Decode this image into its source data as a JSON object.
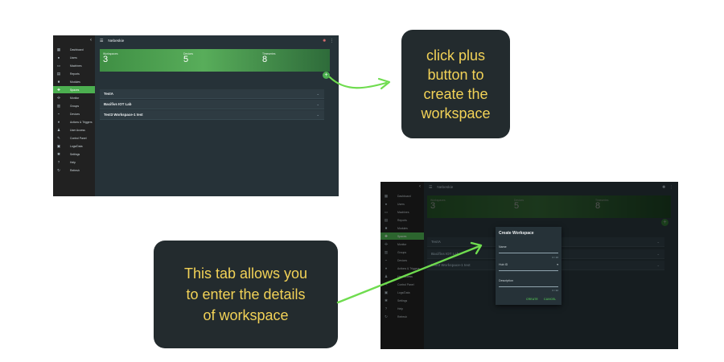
{
  "colors": {
    "accent": "#4caf50",
    "callout_bg": "#232b2e",
    "callout_text": "#f2d257",
    "arrow": "#6fdc4f"
  },
  "app": {
    "title": "Nebeskie",
    "sidebar_items": [
      {
        "label": "Dashboard",
        "icon": "dashboard-icon"
      },
      {
        "label": "Users",
        "icon": "users-icon"
      },
      {
        "label": "Machines",
        "icon": "machines-icon"
      },
      {
        "label": "Reports",
        "icon": "reports-icon"
      },
      {
        "label": "Modules",
        "icon": "modules-icon"
      },
      {
        "label": "Spaces",
        "icon": "spaces-icon"
      },
      {
        "label": "Monitor",
        "icon": "monitor-icon"
      },
      {
        "label": "Groups",
        "icon": "groups-icon"
      },
      {
        "label": "Devices",
        "icon": "devices-icon"
      },
      {
        "label": "Actions & Triggers",
        "icon": "actions-icon"
      },
      {
        "label": "User Access",
        "icon": "user-access-icon"
      },
      {
        "label": "Control Panel",
        "icon": "control-panel-icon"
      },
      {
        "label": "Logs/Data",
        "icon": "logs-icon"
      },
      {
        "label": "Settings",
        "icon": "settings-icon"
      },
      {
        "label": "Help",
        "icon": "help-icon"
      },
      {
        "label": "Refresh",
        "icon": "refresh-icon"
      }
    ],
    "stats": [
      {
        "label": "Workspaces",
        "value": "3"
      },
      {
        "label": "Devices",
        "value": "5"
      },
      {
        "label": "Timeseries",
        "value": "8"
      }
    ],
    "fab_label": "+",
    "workspaces": [
      "TestA",
      "Bacifivs IOT Lab",
      "Test3 Workspace-1 test"
    ],
    "chevron": "⌄",
    "collapse_glyph": "‹",
    "menu_glyph": "☰",
    "kebab_glyph": "⋮",
    "avatar_glyph": "✺"
  },
  "dialog": {
    "title": "Create Workspace",
    "name_label": "Name",
    "name_counter": "0 / 16",
    "hub_label": "Hub ID",
    "hub_caret": "▾",
    "description_label": "Description",
    "description_counter": "0 / 32",
    "create_label": "CREATE",
    "cancel_label": "CANCEL"
  },
  "callouts": {
    "top": [
      "click plus",
      "button to",
      "create the",
      "workspace"
    ],
    "bottom": [
      "This tab allows you",
      "to  enter the details",
      "of workspace"
    ]
  }
}
